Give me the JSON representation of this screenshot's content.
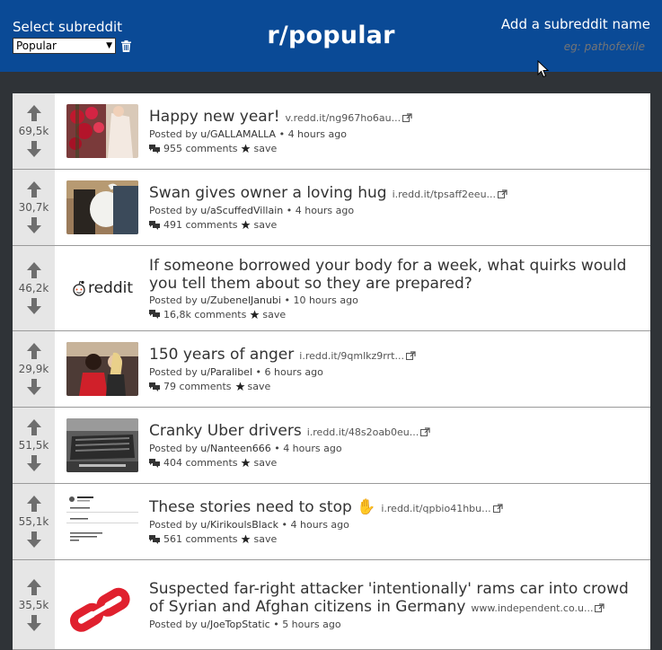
{
  "header": {
    "select_label": "Select subreddit",
    "select_value": "Popular",
    "title": "r/popular",
    "add_label": "Add a subreddit name",
    "add_placeholder": "eg: pathofexile",
    "bg_color": "#0a4a96"
  },
  "posts": [
    {
      "score": "69,5k",
      "title": "Happy new year!",
      "domain": "v.redd.it/ng967ho6au...",
      "posted_by": "Posted by",
      "author": "u/GALLAMALLA",
      "time": "• 4 hours ago",
      "comments": "955 comments",
      "save": "save",
      "thumb": "roses-photo"
    },
    {
      "score": "30,7k",
      "title": "Swan gives owner a loving hug",
      "domain": "i.redd.it/tpsaff2eeu...",
      "posted_by": "Posted by",
      "author": "u/aScuffedVillain",
      "time": "• 4 hours ago",
      "comments": "491 comments",
      "save": "save",
      "thumb": "swan-photo"
    },
    {
      "score": "46,2k",
      "title": "If someone borrowed your body for a week, what quirks would you tell them about so they are prepared?",
      "domain": "",
      "posted_by": "Posted by",
      "author": "u/ZubenelJanubi",
      "time": "• 10 hours ago",
      "comments": "16,8k comments",
      "save": "save",
      "thumb": "reddit-logo",
      "thumb_text": "reddit"
    },
    {
      "score": "29,9k",
      "title": "150 years of anger",
      "domain": "i.redd.it/9qmlkz9rrt...",
      "posted_by": "Posted by",
      "author": "u/Paralibel",
      "time": "• 6 hours ago",
      "comments": "79 comments",
      "save": "save",
      "thumb": "people-photo"
    },
    {
      "score": "51,5k",
      "title": "Cranky Uber drivers",
      "domain": "i.redd.it/48s2oab0eu...",
      "posted_by": "Posted by",
      "author": "u/Nanteen666",
      "time": "• 4 hours ago",
      "comments": "404 comments",
      "save": "save",
      "thumb": "car-photo"
    },
    {
      "score": "55,1k",
      "title": "These stories need to stop ✋",
      "domain": "i.redd.it/qpbio41hbu...",
      "posted_by": "Posted by",
      "author": "u/KirikoulsBlack",
      "time": "• 4 hours ago",
      "comments": "561 comments",
      "save": "save",
      "thumb": "tweet-screenshot"
    },
    {
      "score": "35,5k",
      "title": "Suspected far-right attacker 'intentionally' rams car into crowd of Syrian and Afghan citizens in Germany",
      "domain": "www.independent.co.u...",
      "posted_by": "Posted by",
      "author": "u/JoeTopStatic",
      "time": "• 5 hours ago",
      "comments": "",
      "save": "",
      "thumb": "independent-logo"
    }
  ]
}
